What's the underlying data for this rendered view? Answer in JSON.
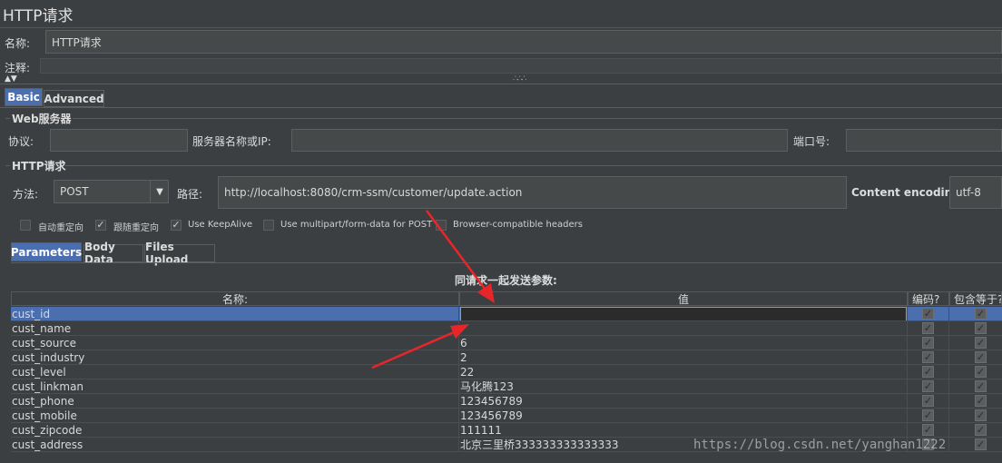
{
  "window_title": "HTTP请求",
  "name_label": "名称:",
  "name_value": "HTTP请求",
  "comment_label": "注释:",
  "tabs": [
    "Basic",
    "Advanced"
  ],
  "web_server": {
    "group_title": "Web服务器",
    "protocol_label": "协议:",
    "protocol_value": "",
    "server_label": "服务器名称或IP:",
    "server_value": "",
    "port_label": "端口号:",
    "port_value": ""
  },
  "http_request": {
    "group_title": "HTTP请求",
    "method_label": "方法:",
    "method_value": "POST",
    "path_label": "路径:",
    "path_value": "http://localhost:8080/crm-ssm/customer/update.action",
    "encoding_label": "Content encoding:",
    "encoding_value": "utf-8"
  },
  "options": [
    {
      "label": "自动重定向",
      "checked": false
    },
    {
      "label": "跟随重定向",
      "checked": true
    },
    {
      "label": "Use KeepAlive",
      "checked": true
    },
    {
      "label": "Use multipart/form-data for POST",
      "checked": false
    },
    {
      "label": "Browser-compatible headers",
      "checked": false
    }
  ],
  "param_tabs": [
    "Parameters",
    "Body Data",
    "Files Upload"
  ],
  "params_caption": "同请求一起发送参数:",
  "columns": [
    "名称:",
    "值",
    "编码?",
    "包含等于?"
  ],
  "params": [
    {
      "name": "cust_id",
      "value": ""
    },
    {
      "name": "cust_name",
      "value": ""
    },
    {
      "name": "cust_source",
      "value": "6"
    },
    {
      "name": "cust_industry",
      "value": "2"
    },
    {
      "name": "cust_level",
      "value": "22"
    },
    {
      "name": "cust_linkman",
      "value": "马化腾123"
    },
    {
      "name": "cust_phone",
      "value": "123456789"
    },
    {
      "name": "cust_mobile",
      "value": "123456789"
    },
    {
      "name": "cust_zipcode",
      "value": "111111"
    },
    {
      "name": "cust_address",
      "value": "北京三里桥333333333333333"
    }
  ],
  "watermark": "https://blog.csdn.net/yanghan1222",
  "colors": {
    "accent": "#4b6eaf",
    "annotation_arrow": "#e8262a",
    "background": "#3b3f42"
  }
}
